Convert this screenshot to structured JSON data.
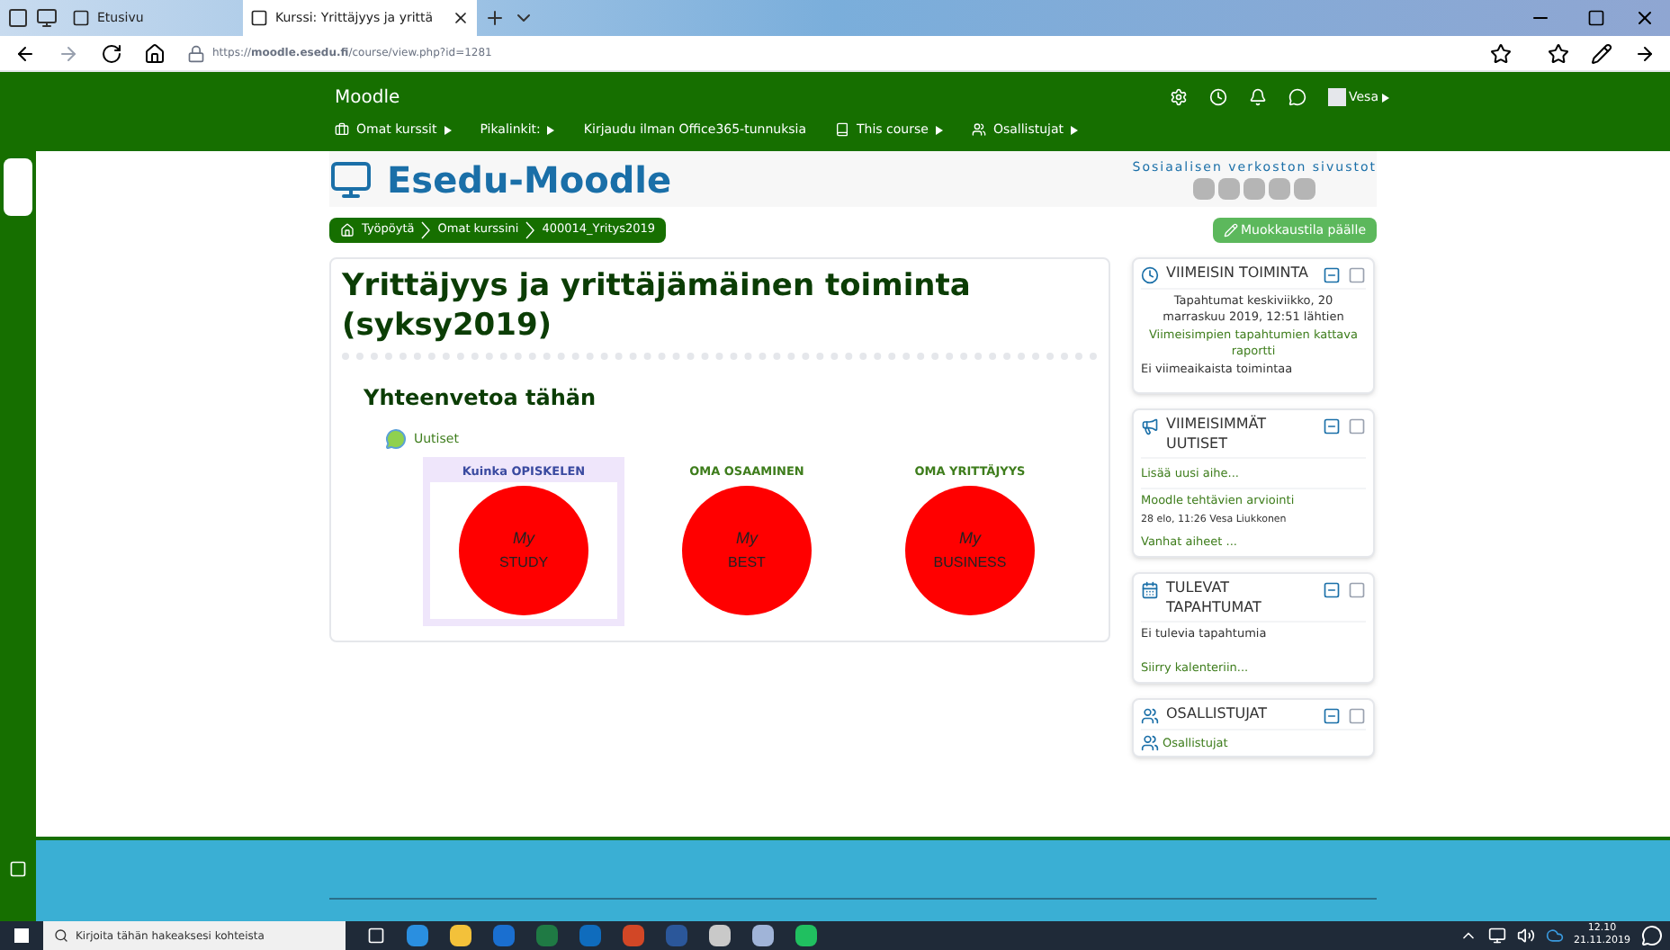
{
  "browser": {
    "tabs": [
      {
        "label": "Etusivu",
        "selected": false
      },
      {
        "label": "Kurssi: Yrittäjyys ja yrittä",
        "selected": true
      }
    ],
    "url": "https://**moodle.esedu.fi**/course/view.php?id=1281"
  },
  "navbar": {
    "site_name": "Moodle",
    "user": "Vesa",
    "menu": [
      {
        "label": "Omat kurssit",
        "dropdown": true
      },
      {
        "label": "Pikalinkit:",
        "dropdown": true
      },
      {
        "label": "Kirjaudu ilman Office365-tunnuksia",
        "dropdown": false
      },
      {
        "label": "This course",
        "dropdown": true
      },
      {
        "label": "Osallistujat",
        "dropdown": true
      }
    ]
  },
  "header": {
    "logo": "Esedu-Moodle",
    "social_title": "Sosiaalisen verkoston sivustot"
  },
  "breadcrumb": [
    "Työpöytä",
    "Omat kurssini",
    "400014_Yritys2019"
  ],
  "edit_button": "Muokkaustila päälle",
  "course": {
    "title": "Yrittäjyys ja yrittäjämäinen toiminta (syksy2019)",
    "section_title": "Yhteenvetoa tähän",
    "forum_link": "Uutiset",
    "tiles": [
      {
        "heading": "Kuinka OPISKELEN",
        "line1": "My",
        "line2": "STUDY",
        "highlighted": true
      },
      {
        "heading": "OMA OSAAMINEN",
        "line1": "My",
        "line2": "BEST",
        "highlighted": false
      },
      {
        "heading": "OMA YRITTÄJYYS",
        "line1": "My",
        "line2": "BUSINESS",
        "highlighted": false
      }
    ]
  },
  "blocks": [
    {
      "title": "VIIMEISIN TOIMINTA",
      "items": [
        {
          "kind": "center",
          "text": "Tapahtumat keskiviikko, 20 marraskuu 2019, 12:51 lähtien"
        },
        {
          "kind": "center_link",
          "text": "Viimeisimpien tapahtumien kattava raportti"
        },
        {
          "kind": "text",
          "text": "Ei viimeaikaista toimintaa"
        }
      ]
    },
    {
      "title": "VIIMEISIMMÄT UUTISET",
      "items": [
        {
          "kind": "link",
          "text": "Lisää uusi aihe..."
        },
        {
          "kind": "divider_link",
          "text": "Moodle tehtävien arviointi"
        },
        {
          "kind": "meta",
          "text": "28 elo, 11:26 Vesa Liukkonen"
        },
        {
          "kind": "link",
          "text": "Vanhat aiheet ..."
        }
      ]
    },
    {
      "title": "TULEVAT TAPAHTUMAT",
      "items": [
        {
          "kind": "text",
          "text": "Ei tulevia tapahtumia"
        },
        {
          "kind": "link",
          "text": "Siirry kalenteriin..."
        }
      ]
    },
    {
      "title": "OSALLISTUJAT",
      "items": [
        {
          "kind": "people_link",
          "text": "Osallistujat"
        }
      ]
    }
  ],
  "taskbar": {
    "search_placeholder": "Kirjoita tähän hakeaksesi kohteista",
    "time": "12.10",
    "date": "21.11.2019"
  }
}
